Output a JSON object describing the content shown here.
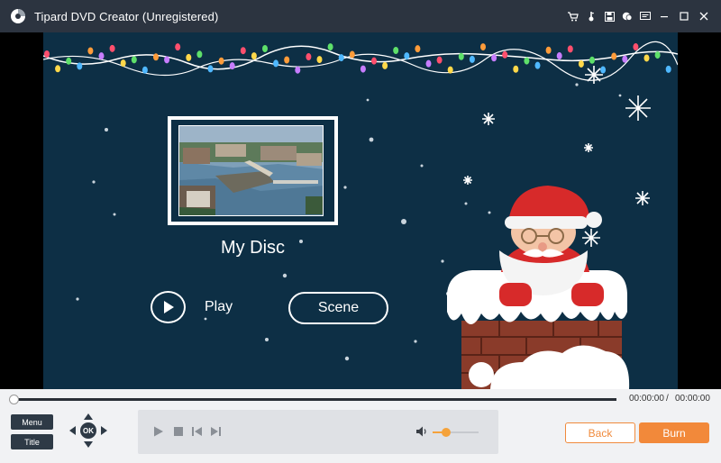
{
  "window": {
    "title": "Tipard DVD Creator (Unregistered)",
    "icons": [
      "cart-icon",
      "key-icon",
      "save-icon",
      "chat-icon",
      "menu-icon",
      "minimize-icon",
      "maximize-icon",
      "close-icon"
    ]
  },
  "menu_preview": {
    "disc_title": "My Disc",
    "play_label": "Play",
    "scene_label": "Scene",
    "theme": "christmas-santa-chimney"
  },
  "playback": {
    "current_time": "00:00:00",
    "separator": "/",
    "total_time": "00:00:00",
    "progress": 0,
    "volume": 0.3
  },
  "controls": {
    "menu_label": "Menu",
    "title_label": "Title",
    "ok_label": "OK",
    "back_label": "Back",
    "burn_label": "Burn"
  },
  "colors": {
    "titlebar": "#2c3440",
    "menu_background": "#0d2f45",
    "accent": "#f2893a",
    "panel": "#f1f2f4"
  }
}
